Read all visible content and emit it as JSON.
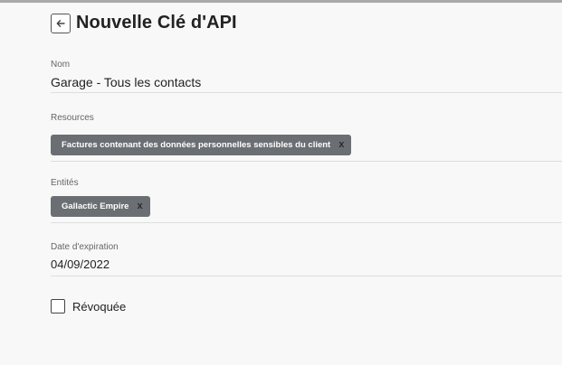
{
  "page": {
    "title": "Nouvelle Clé d'API",
    "back_icon": "arrow-left-icon"
  },
  "form": {
    "name": {
      "label": "Nom",
      "value": "Garage - Tous les contacts"
    },
    "resources": {
      "label": "Resources",
      "chips": [
        {
          "label": "Factures contenant des données personnelles sensibles du client",
          "remove": "x"
        }
      ]
    },
    "entities": {
      "label": "Entités",
      "chips": [
        {
          "label": "Gallactic Empire",
          "remove": "x"
        }
      ]
    },
    "expiration": {
      "label": "Date d'expiration",
      "value": "04/09/2022"
    },
    "revoked": {
      "label": "Révoquée",
      "checked": false
    }
  }
}
